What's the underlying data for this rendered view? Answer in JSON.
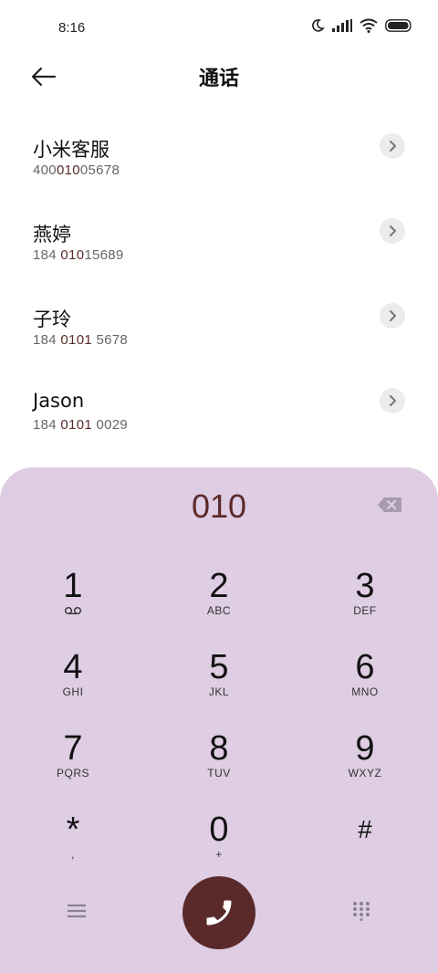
{
  "status": {
    "time": "8:16"
  },
  "header": {
    "title": "通话"
  },
  "contacts": [
    {
      "name": "小米客服",
      "num_pre": "400",
      "num_hl": "010",
      "num_post": "05678"
    },
    {
      "name": "燕婷",
      "num_pre": "184 ",
      "num_hl": "010",
      "num_post": "15689"
    },
    {
      "name": "子玲",
      "num_pre": "184 ",
      "num_hl": "0101",
      "num_post": " 5678"
    },
    {
      "name": "Jason",
      "num_pre": "184 ",
      "num_hl": "0101",
      "num_post": " 0029"
    }
  ],
  "dialer": {
    "input": "010",
    "keys": [
      {
        "digit": "1",
        "letters": ""
      },
      {
        "digit": "2",
        "letters": "ABC"
      },
      {
        "digit": "3",
        "letters": "DEF"
      },
      {
        "digit": "4",
        "letters": "GHI"
      },
      {
        "digit": "5",
        "letters": "JKL"
      },
      {
        "digit": "6",
        "letters": "MNO"
      },
      {
        "digit": "7",
        "letters": "PQRS"
      },
      {
        "digit": "8",
        "letters": "TUV"
      },
      {
        "digit": "9",
        "letters": "WXYZ"
      },
      {
        "digit": "*",
        "letters": ","
      },
      {
        "digit": "0",
        "letters": "+"
      },
      {
        "digit": "#",
        "letters": ""
      }
    ]
  },
  "icons": {
    "back": "arrow-left-icon",
    "chevron": "chevron-right-icon",
    "backspace": "backspace-icon",
    "voicemail": "voicemail-icon",
    "menu": "menu-icon",
    "call": "phone-icon",
    "keypad": "keypad-icon"
  },
  "colors": {
    "accent": "#5a2a2a",
    "dialer_bg": "#decde3"
  }
}
